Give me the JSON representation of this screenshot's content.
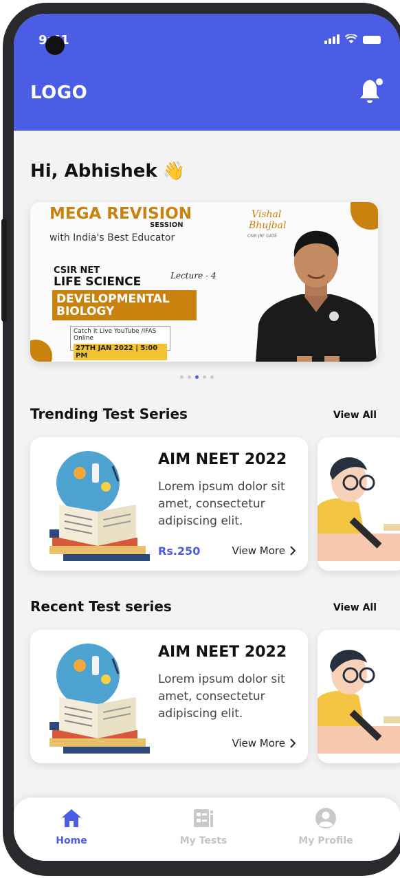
{
  "status": {
    "time": "9:41"
  },
  "header": {
    "logo": "LOGO"
  },
  "greeting": {
    "text": "Hi, Abhishek",
    "emoji": "👋"
  },
  "banner": {
    "mega": "MEGA REVISION",
    "session": "SESSION",
    "with": "with India's Best Educator",
    "csir": "CSIR NET",
    "subject": "LIFE SCIENCE",
    "lecture": "Lecture - 4",
    "topic_line1": "DEVELOPMENTAL",
    "topic_line2": "BIOLOGY",
    "catch": "Catch it Live YouTube /IFAS Online",
    "date": "27TH JAN 2022 | 5:00 PM",
    "educator_first": "Vishal",
    "educator_last": "Bhujbal",
    "educator_creds": "CSIR JRF GATE"
  },
  "carousel": {
    "count": 5,
    "active": 3
  },
  "trending": {
    "title": "Trending Test Series",
    "view_all": "View All",
    "card": {
      "title": "AIM NEET 2022",
      "description": "Lorem ipsum dolor sit amet, consectetur adipiscing elit.",
      "price": "Rs.250",
      "more": "View More"
    }
  },
  "recent": {
    "title": "Recent Test series",
    "view_all": "View All",
    "card": {
      "title": "AIM NEET 2022",
      "description": "Lorem ipsum dolor sit amet, consectetur adipiscing elit.",
      "more": "View More"
    }
  },
  "nav": {
    "home": "Home",
    "tests": "My Tests",
    "profile": "My Profile"
  },
  "colors": {
    "accent": "#4b5de4",
    "banner_gold": "#c8820d"
  },
  "icons": [
    "bell-icon",
    "home-icon",
    "tests-icon",
    "profile-icon",
    "chevron-right-icon"
  ]
}
